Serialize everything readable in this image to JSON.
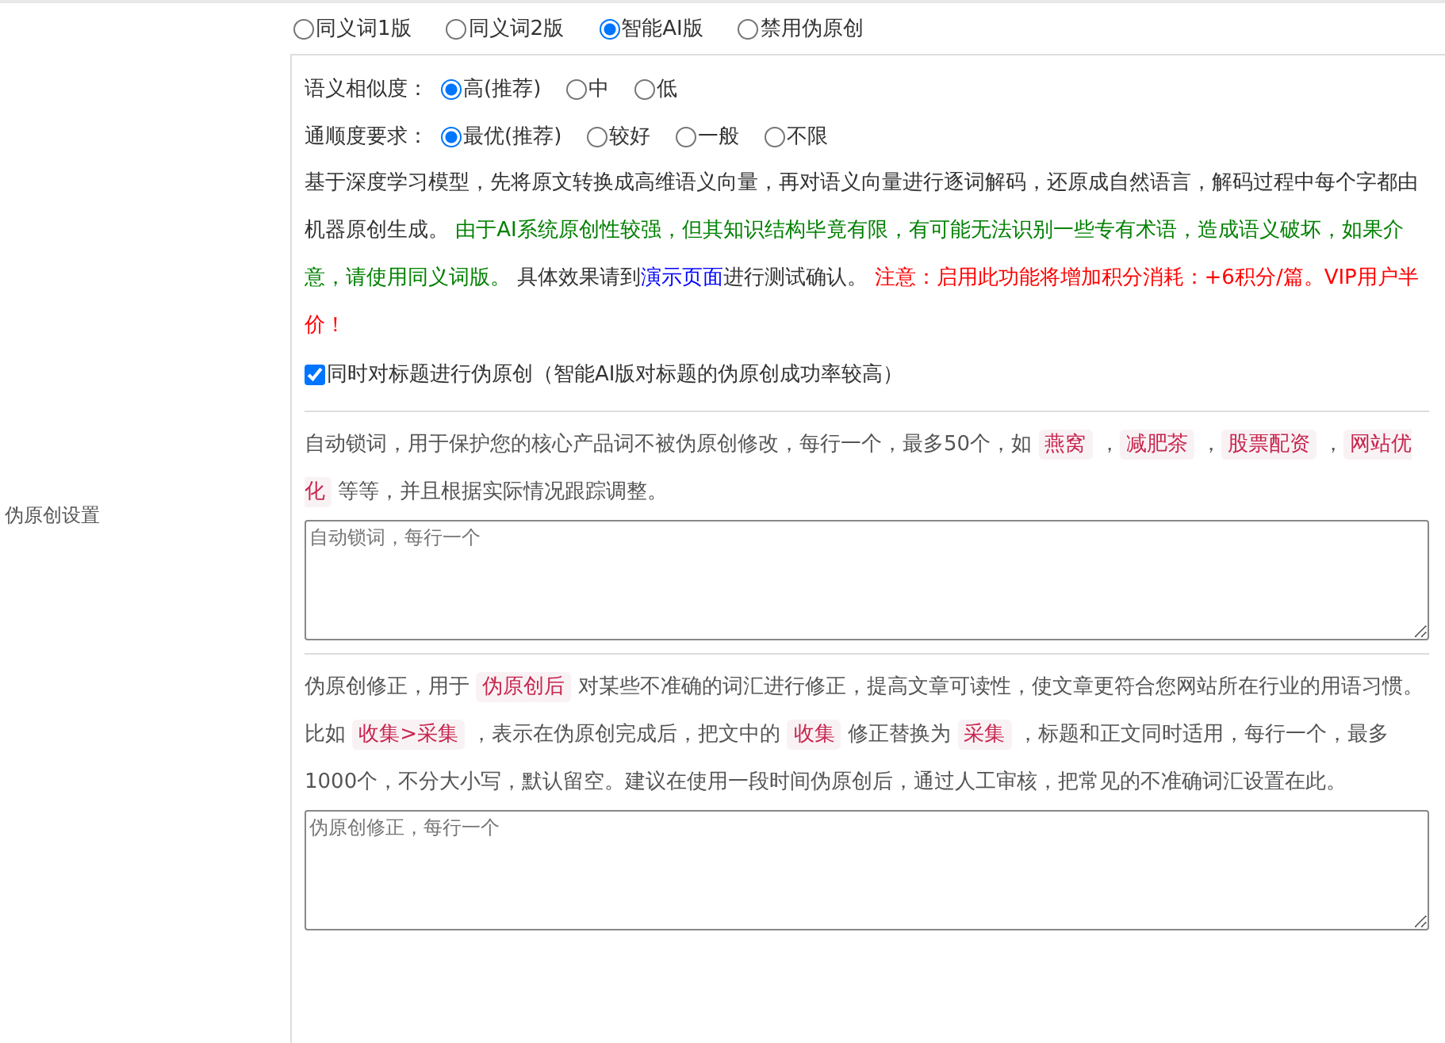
{
  "mode_options": [
    {
      "label": "同义词1版",
      "selected": false
    },
    {
      "label": "同义词2版",
      "selected": false
    },
    {
      "label": "智能AI版",
      "selected": true
    },
    {
      "label": "禁用伪原创",
      "selected": false
    }
  ],
  "similarity": {
    "label": "语义相似度：",
    "options": [
      {
        "label": "高(推荐)",
        "selected": true
      },
      {
        "label": "中",
        "selected": false
      },
      {
        "label": "低",
        "selected": false
      }
    ]
  },
  "fluency": {
    "label": "通顺度要求：",
    "options": [
      {
        "label": "最优(推荐)",
        "selected": true
      },
      {
        "label": "较好",
        "selected": false
      },
      {
        "label": "一般",
        "selected": false
      },
      {
        "label": "不限",
        "selected": false
      }
    ]
  },
  "ai_description": [
    {
      "kind": "plain",
      "text": "基于深度学习模型，先将原文转换成高维语义向量，再对语义向量进行逐词解码，还原成自然语言，解码过程中每个字都由机器原创生成。 "
    },
    {
      "kind": "green",
      "text": "由于AI系统原创性较强，但其知识结构毕竟有限，有可能无法识别一些专有术语，造成语义破坏，如果介意，请使用同义词版。"
    },
    {
      "kind": "plain",
      "text": " 具体效果请到"
    },
    {
      "kind": "link",
      "text": "演示页面"
    },
    {
      "kind": "plain",
      "text": "进行测试确认。 "
    },
    {
      "kind": "red",
      "text": "注意：启用此功能将增加积分消耗：+6积分/篇。VIP用户半价！"
    }
  ],
  "title_checkbox": {
    "label": "同时对标题进行伪原创（智能AI版对标题的伪原创成功率较高）",
    "checked": true
  },
  "side_label": "伪原创设置",
  "lock_words": {
    "description": [
      {
        "kind": "plain",
        "text": "自动锁词，用于保护您的核心产品词不被伪原创修改，每行一个，最多50个，如 "
      },
      {
        "kind": "tag",
        "text": "燕窝"
      },
      {
        "kind": "plain",
        "text": " ，"
      },
      {
        "kind": "tag",
        "text": "减肥茶"
      },
      {
        "kind": "plain",
        "text": " ，"
      },
      {
        "kind": "tag",
        "text": "股票配资"
      },
      {
        "kind": "plain",
        "text": " ，"
      },
      {
        "kind": "tag",
        "text": "网站优化"
      },
      {
        "kind": "plain",
        "text": " 等等，并且根据实际情况跟踪调整。"
      }
    ],
    "placeholder": "自动锁词，每行一个"
  },
  "correction": {
    "description": [
      {
        "kind": "plain",
        "text": "伪原创修正，用于 "
      },
      {
        "kind": "tag",
        "text": "伪原创后"
      },
      {
        "kind": "plain",
        "text": " 对某些不准确的词汇进行修正，提高文章可读性，使文章更符合您网站所在行业的用语习惯。比如 "
      },
      {
        "kind": "tag",
        "text": "收集>采集"
      },
      {
        "kind": "plain",
        "text": " ，表示在伪原创完成后，把文中的 "
      },
      {
        "kind": "tag",
        "text": "收集"
      },
      {
        "kind": "plain",
        "text": " 修正替换为 "
      },
      {
        "kind": "tag",
        "text": "采集"
      },
      {
        "kind": "plain",
        "text": " ，标题和正文同时适用，每行一个，最多1000个，不分大小写，默认留空。建议在使用一段时间伪原创后，通过人工审核，把常见的不准确词汇设置在此。"
      }
    ],
    "placeholder": "伪原创修正，每行一个"
  }
}
